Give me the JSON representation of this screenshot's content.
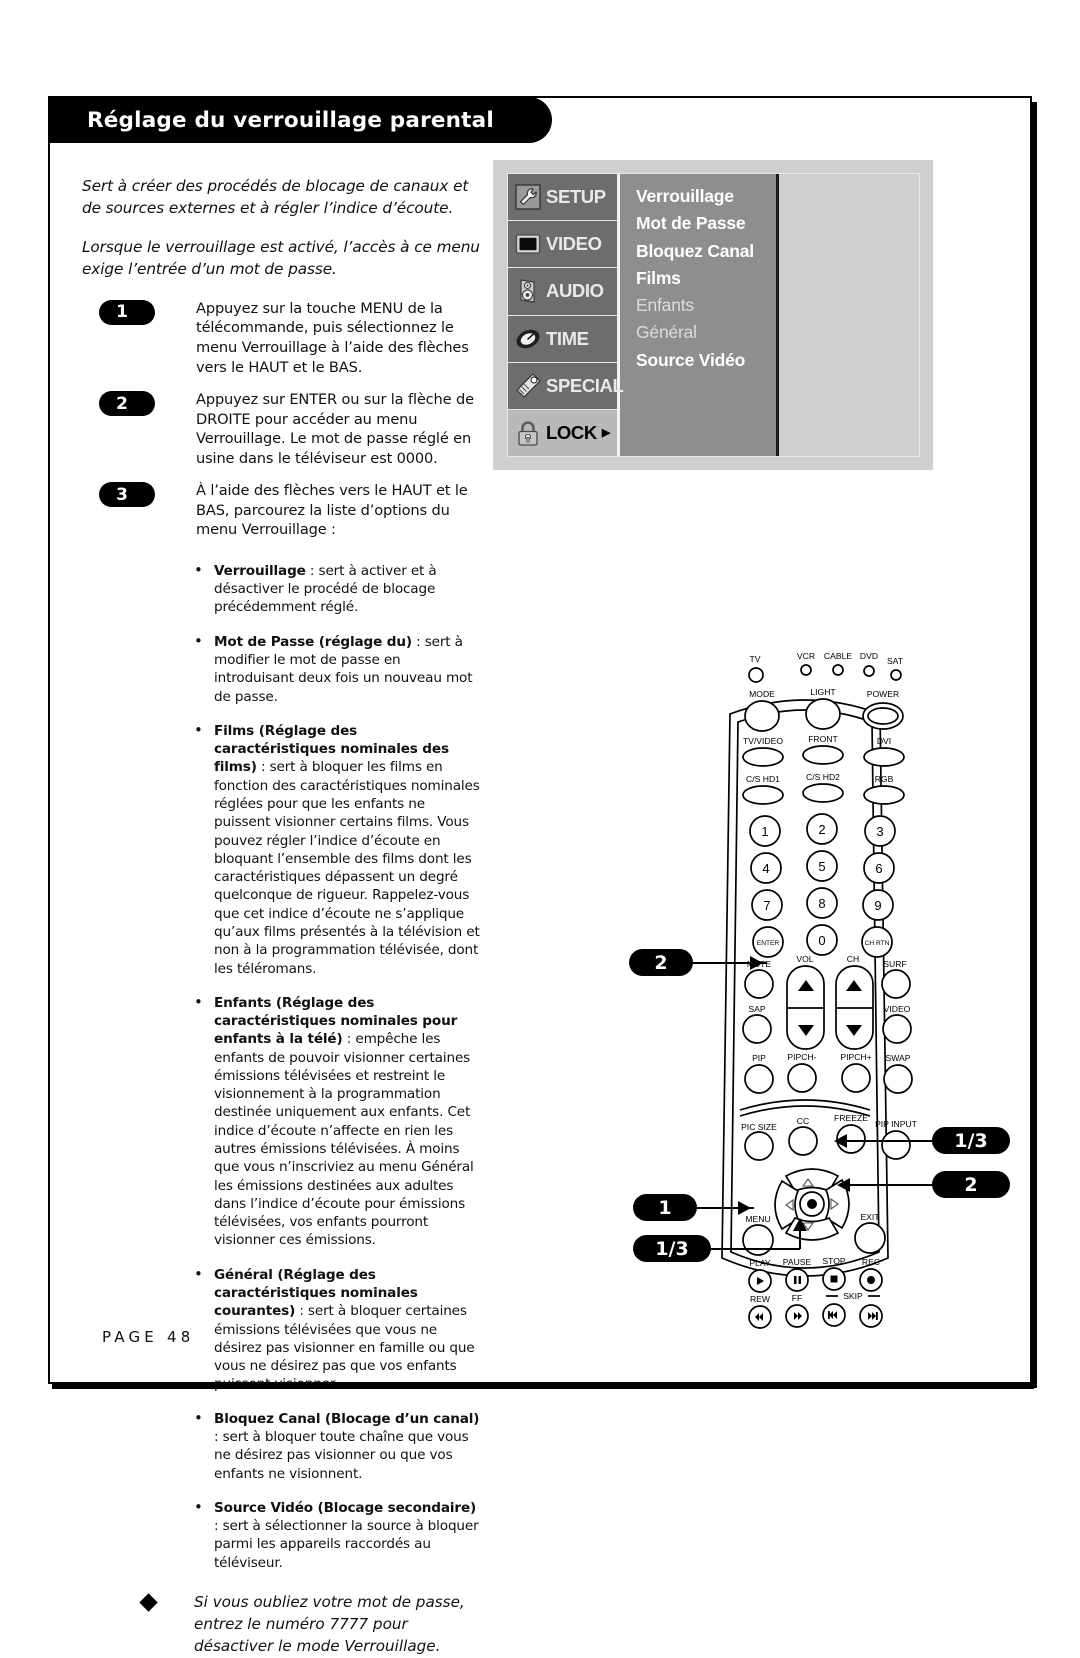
{
  "header": {
    "title": "Réglage du verrouillage parental"
  },
  "intro": {
    "para1": "Sert à créer des procédés de blocage de canaux et de sources externes et à régler l’indice d’écoute.",
    "para2": "Lorsque le verrouillage est activé, l’accès à ce menu exige l’entrée d’un mot de passe."
  },
  "steps": [
    {
      "number": "1",
      "text": "Appuyez sur la touche MENU de la télécommande, puis sélectionnez le menu Verrouillage à l’aide des flèches vers le HAUT et le BAS."
    },
    {
      "number": "2",
      "text": "Appuyez sur ENTER ou sur la flèche de DROITE pour accéder au menu Verrouillage. Le mot de passe réglé en usine dans le téléviseur est 0000."
    },
    {
      "number": "3",
      "text": "À l’aide des flèches vers le HAUT et le BAS, parcourez la liste d’options du menu Verrouillage :"
    }
  ],
  "bullets": [
    {
      "term": "Verrouillage",
      "body": " : sert à activer et à désactiver le procédé de blocage précédemment réglé."
    },
    {
      "term": "Mot de Passe (réglage du)",
      "body": " : sert à modifier le mot de passe en introduisant deux fois un nouveau mot de passe."
    },
    {
      "term": "Films (Réglage des caractéristiques nominales des films)",
      "body": " : sert à bloquer les films en fonction des caractéristiques nominales réglées pour que les enfants ne puissent visionner certains films. Vous pouvez régler l’indice d’écoute en bloquant l’ensemble des films dont les caractéristiques dépassent un degré quelconque de rigueur. Rappelez-vous que cet indice d’écoute ne s’applique qu’aux films présentés à la télévision et non à la programmation télévisée, dont les téléromans."
    },
    {
      "term": "Enfants (Réglage des caractéristiques nominales pour enfants à la télé)",
      "body": " : empêche les enfants de pouvoir visionner certaines émissions télévisées et restreint le visionnement à la programmation destinée uniquement aux enfants. Cet indice d’écoute n’affecte en rien les autres émissions télévisées. À moins que vous n’inscriviez au menu Général les émissions destinées aux adultes dans l’indice d’écoute pour émissions télévisées, vos enfants pourront visionner ces émissions."
    },
    {
      "term": "Général (Réglage des caractéristiques nominales courantes)",
      "body": " : sert à bloquer certaines émissions télévisées que vous ne désirez pas visionner en famille ou que vous ne désirez pas que vos enfants puissent visionner."
    },
    {
      "term": "Bloquez Canal (Blocage d’un canal)",
      "body": " : sert à bloquer toute chaîne que vous ne désirez pas visionner ou que vos enfants ne visionnent."
    },
    {
      "term": "Source Vidéo (Blocage secondaire)",
      "body": " : sert à sélectionner la source à bloquer parmi les appareils raccordés au téléviseur."
    }
  ],
  "note": {
    "text": "Si vous oubliez votre mot de passe, entrez le numéro 7777 pour désactiver le mode Verrouillage."
  },
  "footer": {
    "page_label": "PAGE 48"
  },
  "osd": {
    "icon_menu": [
      {
        "label": "SETUP",
        "icon": "wrench-icon",
        "selected": false,
        "arrow": ""
      },
      {
        "label": "VIDEO",
        "icon": "screen-icon",
        "selected": false,
        "arrow": ""
      },
      {
        "label": "AUDIO",
        "icon": "speaker-icon",
        "selected": false,
        "arrow": ""
      },
      {
        "label": "TIME",
        "icon": "clock-icon",
        "selected": false,
        "arrow": ""
      },
      {
        "label": "SPECIAL",
        "icon": "tag-icon",
        "selected": false,
        "arrow": ""
      },
      {
        "label": "LOCK",
        "icon": "lock-icon",
        "selected": true,
        "arrow": "▶"
      }
    ],
    "options": [
      {
        "label": "Verrouillage",
        "dim": false
      },
      {
        "label": "Mot de Passe",
        "dim": false
      },
      {
        "label": "Bloquez  Canal",
        "dim": false
      },
      {
        "label": "Films",
        "dim": false
      },
      {
        "label": "Enfants",
        "dim": true
      },
      {
        "label": "Général",
        "dim": true
      },
      {
        "label": "Source Vidéo",
        "dim": false
      }
    ]
  },
  "callouts": {
    "enter": "2",
    "up_arrow": "1/3",
    "right_arrow": "2",
    "menu": "1",
    "down_arrow": "1/3"
  },
  "remote": {
    "device_leds": [
      "TV",
      "VCR",
      "CABLE",
      "DVD",
      "SAT"
    ],
    "row_mode": [
      "MODE",
      "LIGHT",
      "POWER"
    ],
    "row_input": [
      "TV/VIDEO",
      "FRONT",
      "DVI"
    ],
    "row_hd": [
      "C/S HD1",
      "C/S HD2",
      "RGB"
    ],
    "keypad": [
      "1",
      "2",
      "3",
      "4",
      "5",
      "6",
      "7",
      "8",
      "9"
    ],
    "enter_label": "ENTER",
    "zero_label": "0",
    "chrtn_label": "CH RTN",
    "row_mute": [
      "MUTE",
      "VOL",
      "CH",
      "SURF"
    ],
    "row_sap": [
      "SAP",
      "VIDEO"
    ],
    "row_pip": [
      "PIP",
      "PIPCH-",
      "PIPCH+",
      "SWAP"
    ],
    "row_pic": [
      "PIC SIZE",
      "CC",
      "FREEZE",
      "PIP INPUT"
    ],
    "menu_label": "MENU",
    "exit_label": "EXIT",
    "row_play": [
      "PLAY",
      "PAUSE",
      "STOP",
      "REC"
    ],
    "row_rew": [
      "REW",
      "FF",
      "SKIP"
    ]
  },
  "colors": {
    "osd_panel": "#cfcfcf",
    "osd_icon_bar": "#6d6d6d",
    "osd_list": "#8e8e8e",
    "osd_selected": "#b9b9b9",
    "ink": "#000000"
  }
}
